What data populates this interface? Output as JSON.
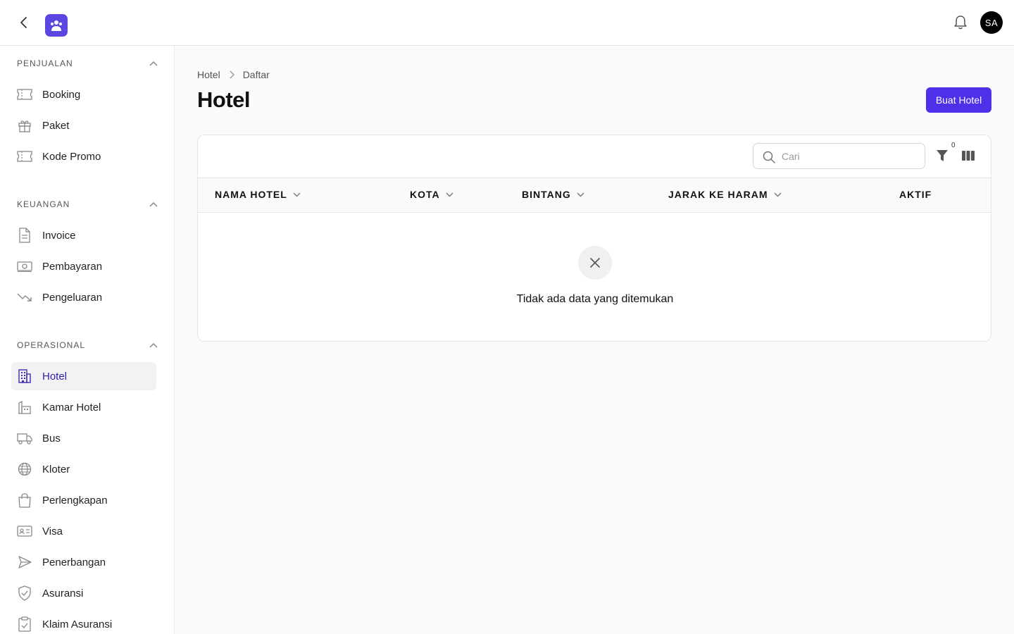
{
  "header": {
    "avatar_initials": "SA",
    "accent_color": "#4f2fe8"
  },
  "sidebar": {
    "sections": [
      {
        "title": "PENJUALAN",
        "items": [
          {
            "label": "Booking",
            "icon": "ticket-icon"
          },
          {
            "label": "Paket",
            "icon": "gift-icon"
          },
          {
            "label": "Kode Promo",
            "icon": "ticket-icon"
          }
        ]
      },
      {
        "title": "KEUANGAN",
        "items": [
          {
            "label": "Invoice",
            "icon": "document-icon"
          },
          {
            "label": "Pembayaran",
            "icon": "banknote-icon"
          },
          {
            "label": "Pengeluaran",
            "icon": "trending-down-icon"
          }
        ]
      },
      {
        "title": "OPERASIONAL",
        "items": [
          {
            "label": "Hotel",
            "icon": "building-icon",
            "active": true
          },
          {
            "label": "Kamar Hotel",
            "icon": "building-room-icon"
          },
          {
            "label": "Bus",
            "icon": "truck-icon"
          },
          {
            "label": "Kloter",
            "icon": "globe-icon"
          },
          {
            "label": "Perlengkapan",
            "icon": "shopping-bag-icon"
          },
          {
            "label": "Visa",
            "icon": "id-card-icon"
          },
          {
            "label": "Penerbangan",
            "icon": "paper-plane-icon"
          },
          {
            "label": "Asuransi",
            "icon": "shield-check-icon"
          },
          {
            "label": "Klaim Asuransi",
            "icon": "clipboard-check-icon"
          }
        ]
      }
    ]
  },
  "breadcrumb": [
    "Hotel",
    "Daftar"
  ],
  "page": {
    "title": "Hotel",
    "create_button": "Buat Hotel"
  },
  "table": {
    "search_placeholder": "Cari",
    "filter_count": "0",
    "columns": [
      {
        "label": "NAMA HOTEL",
        "sortable": true
      },
      {
        "label": "KOTA",
        "sortable": true
      },
      {
        "label": "BINTANG",
        "sortable": true
      },
      {
        "label": "JARAK KE HARAM",
        "sortable": true
      },
      {
        "label": "AKTIF",
        "sortable": false
      }
    ],
    "rows": [],
    "empty_message": "Tidak ada data yang ditemukan"
  }
}
